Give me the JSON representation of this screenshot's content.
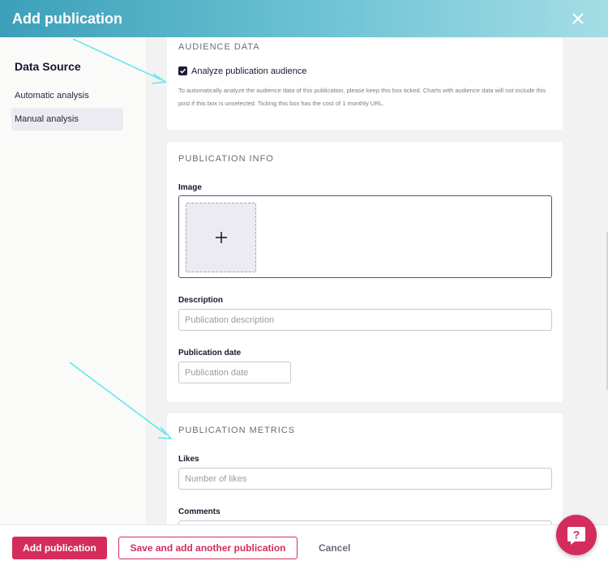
{
  "header": {
    "title": "Add publication",
    "close_icon": "close-icon"
  },
  "sidebar": {
    "title": "Data Source",
    "items": [
      {
        "label": "Automatic analysis",
        "active": false
      },
      {
        "label": "Manual analysis",
        "active": true
      }
    ]
  },
  "audience": {
    "section_title": "AUDIENCE DATA",
    "checkbox_label": "Analyze publication audience",
    "checked": true,
    "help_text": "To automatically analyze the audience data of this publication, please keep this box ticked. Charts with audience data will not include this post if this box is unselected. Ticking this box has the cost of 1 monthly URL."
  },
  "info": {
    "section_title": "PUBLICATION INFO",
    "image_label": "Image",
    "description_label": "Description",
    "description_placeholder": "Publication description",
    "date_label": "Publication date",
    "date_placeholder": "Publication date"
  },
  "metrics": {
    "section_title": "PUBLICATION METRICS",
    "likes_label": "Likes",
    "likes_placeholder": "Number of likes",
    "comments_label": "Comments"
  },
  "footer": {
    "add_label": "Add publication",
    "save_another_label": "Save and add another publication",
    "cancel_label": "Cancel"
  },
  "colors": {
    "accent": "#d42c5d",
    "header_gradient_start": "#3c9fb9",
    "header_gradient_end": "#a5dde5",
    "annotation_arrow": "#5ee6ec"
  }
}
